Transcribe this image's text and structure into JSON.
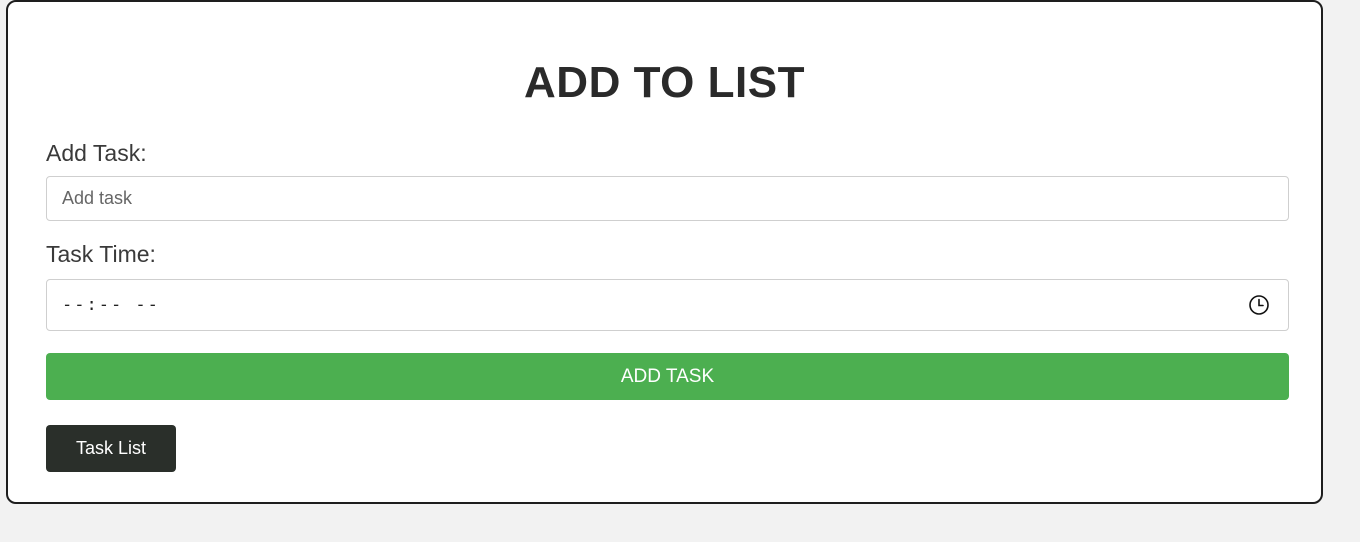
{
  "page": {
    "title": "ADD TO LIST"
  },
  "form": {
    "task_label": "Add Task:",
    "task_placeholder": "Add task",
    "task_value": "",
    "time_label": "Task Time:",
    "time_value": "--:-- --",
    "time_icon": "clock-icon"
  },
  "buttons": {
    "add_task": "ADD TASK",
    "task_list": "Task List"
  },
  "colors": {
    "primary_button": "#4caf50",
    "secondary_button": "#2a2f2a",
    "background": "#f2f2f2",
    "card": "#ffffff"
  }
}
